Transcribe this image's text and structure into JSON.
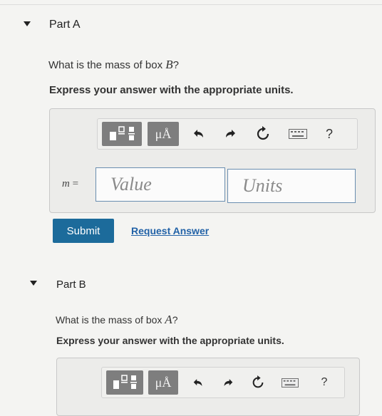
{
  "part_a": {
    "title": "Part A",
    "question_prefix": "What is the mass of box ",
    "question_var": "B",
    "question_suffix": "?",
    "instruction": "Express your answer with the appropriate units.",
    "toolbar": {
      "templates_icon": "fraction-templates-icon",
      "symbols_label": "μÅ",
      "undo_icon": "undo-icon",
      "redo_icon": "redo-icon",
      "reset_icon": "reset-icon",
      "keyboard_icon": "keyboard-icon",
      "help_label": "?"
    },
    "var_label": "m",
    "equals": "=",
    "value_placeholder": "Value",
    "units_placeholder": "Units",
    "submit_label": "Submit",
    "request_label": "Request Answer"
  },
  "part_b": {
    "title": "Part B",
    "question_prefix": "What is the mass of box ",
    "question_var": "A",
    "question_suffix": "?",
    "instruction": "Express your answer with the appropriate units.",
    "toolbar": {
      "symbols_label": "μÅ",
      "help_label": "?"
    }
  },
  "colors": {
    "submit": "#1c6b9b",
    "link": "#2262a7",
    "input_border": "#6a8eb0"
  }
}
